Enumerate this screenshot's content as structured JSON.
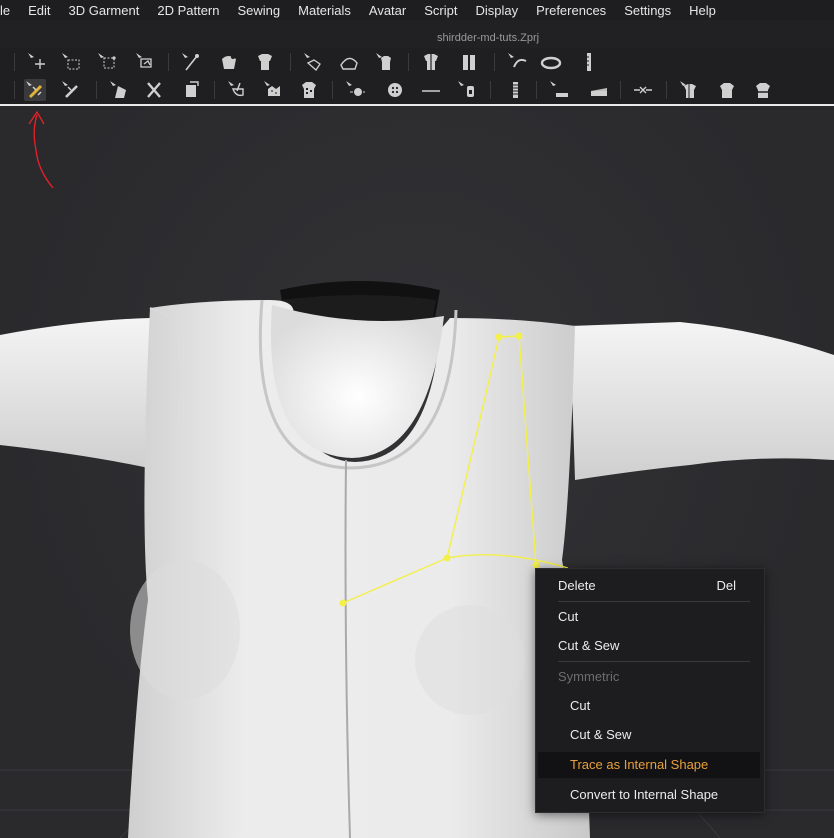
{
  "menubar": {
    "items": [
      "le",
      "Edit",
      "3D Garment",
      "2D Pattern",
      "Sewing",
      "Materials",
      "Avatar",
      "Script",
      "Display",
      "Preferences",
      "Settings",
      "Help"
    ]
  },
  "window": {
    "file_name": "shirdder-md-tuts.Zprj"
  },
  "toolbar1": {
    "tools": [
      "transform-pattern-icon",
      "transform-box-icon",
      "edit-pattern-icon",
      "fold-arrangement-icon",
      "tack-icon",
      "pin-icon",
      "garment-pin-icon",
      "select-mesh-icon",
      "edit-curvature-icon",
      "steam-icon",
      "show-garment-icon",
      "fold-icon",
      "tape-measure-icon",
      "measure-ruler-icon",
      "ruler-icon"
    ]
  },
  "toolbar2": {
    "tools": [
      "edit-texture-icon",
      "transform-texture-icon",
      "segment-sewing-icon",
      "free-sewing-icon",
      "fold-pattern-icon",
      "brush-icon",
      "puckering-icon",
      "graphic-icon",
      "button-icon",
      "buttonhole-icon",
      "select-button-icon",
      "zipper-icon",
      "puckering-line-icon",
      "elastic-icon",
      "trim-icon",
      "avatar-measure-icon",
      "circumference-icon",
      "fitting-icon"
    ]
  },
  "context_menu": {
    "delete": "Delete",
    "delete_shortcut": "Del",
    "cut": "Cut",
    "cut_sew": "Cut & Sew",
    "symmetric_header": "Symmetric",
    "sym_cut": "Cut",
    "sym_cut_sew": "Cut & Sew",
    "trace": "Trace as Internal Shape",
    "convert": "Convert to Internal Shape"
  },
  "colors": {
    "highlight_text": "#e7a03c",
    "selection_line": "#f3f04a",
    "annotation": "#e8202a"
  }
}
